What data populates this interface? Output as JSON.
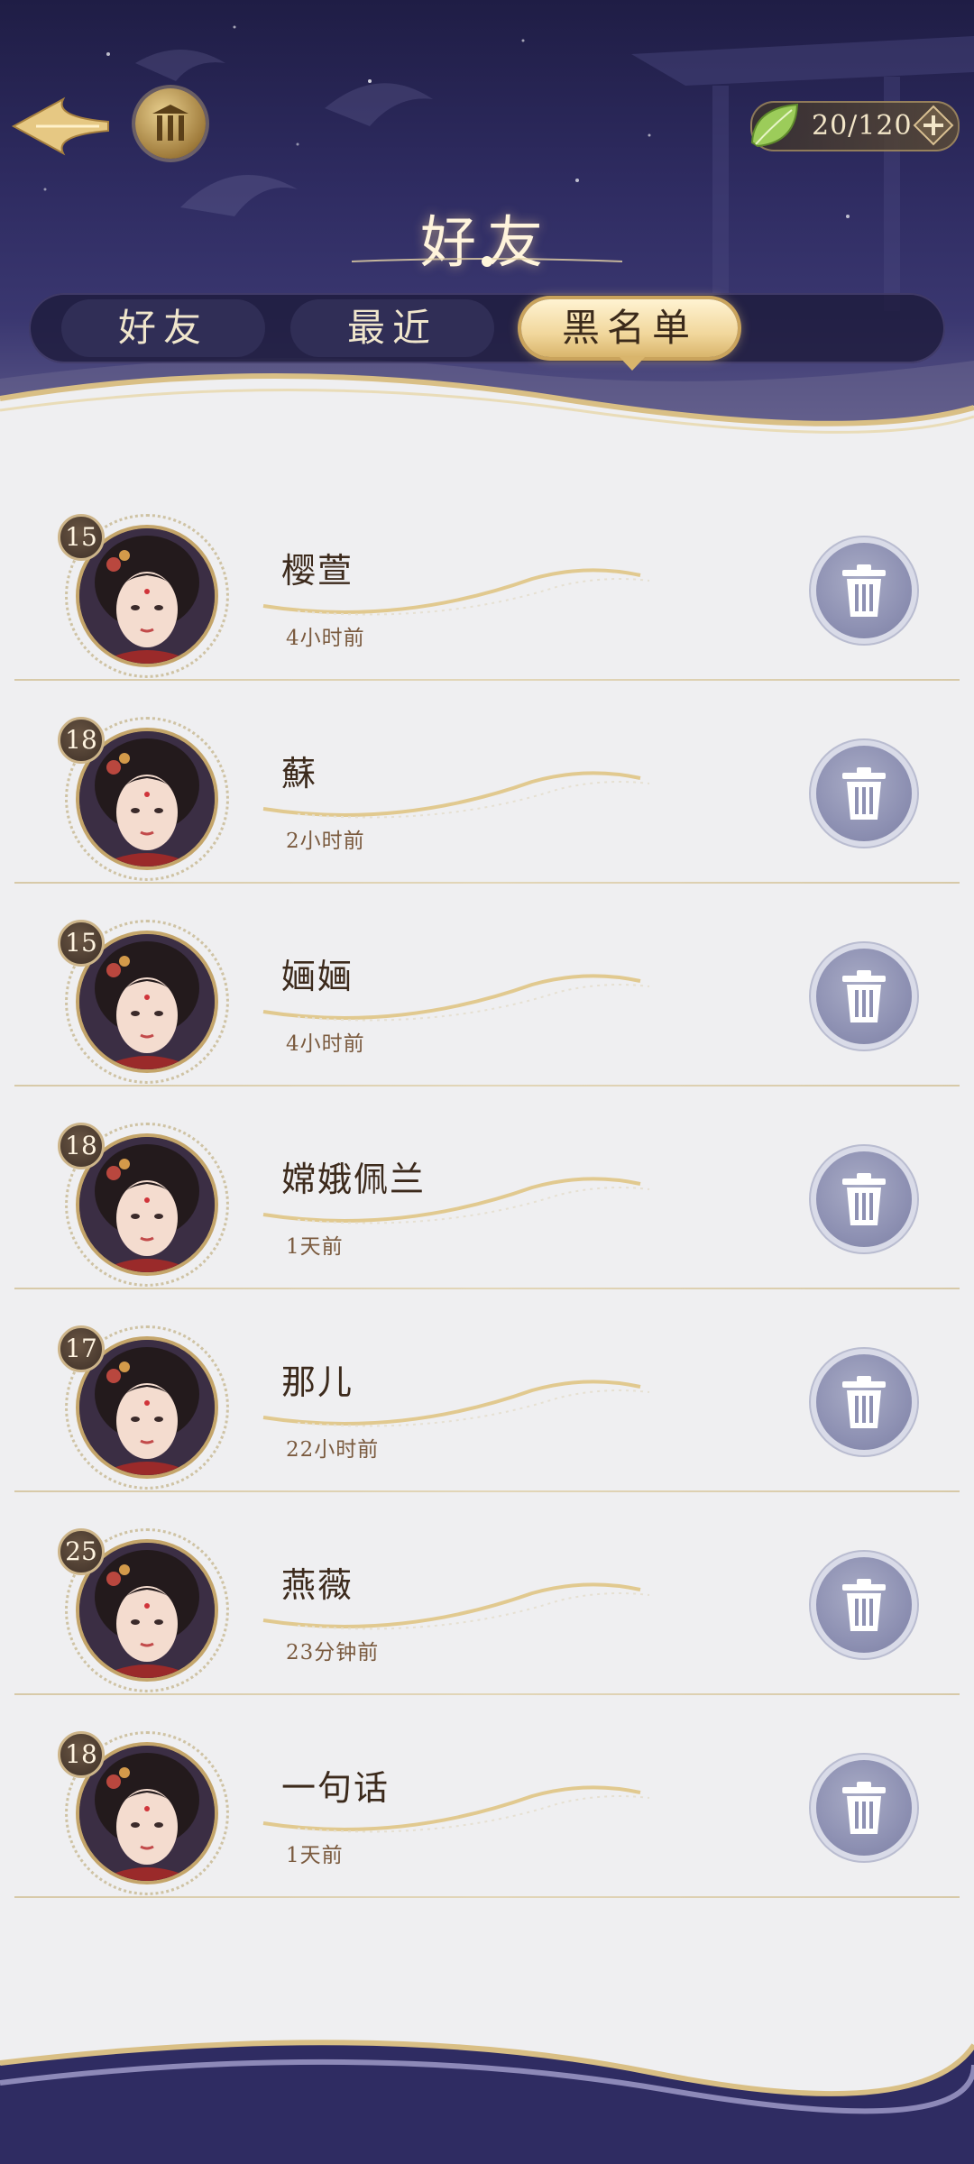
{
  "header": {
    "title": "好友",
    "stamina": "20/120"
  },
  "tabs": [
    {
      "label": "好友",
      "active": false
    },
    {
      "label": "最近",
      "active": false
    },
    {
      "label": "黑名单",
      "active": true
    }
  ],
  "blacklist": [
    {
      "level": "15",
      "name": "樱萱",
      "time": "4小时前"
    },
    {
      "level": "18",
      "name": "蘇",
      "time": "2小时前"
    },
    {
      "level": "15",
      "name": "婳婳",
      "time": "4小时前"
    },
    {
      "level": "18",
      "name": "嫦娥佩兰",
      "time": "1天前"
    },
    {
      "level": "17",
      "name": "那儿",
      "time": "22小时前"
    },
    {
      "level": "25",
      "name": "燕薇",
      "time": "23分钟前"
    },
    {
      "level": "18",
      "name": "一句话",
      "time": "1天前"
    }
  ],
  "icons": {
    "back": "back-arrow-icon",
    "home": "temple-icon",
    "stamina": "leaf-icon",
    "add": "plus-icon",
    "delete": "trash-icon"
  },
  "colors": {
    "accent_gold": "#d9b56c",
    "header_bg": "#2f2c62",
    "list_bg": "#efeff1",
    "name_text": "#3c2a1c",
    "time_text": "#7a5a3e"
  }
}
